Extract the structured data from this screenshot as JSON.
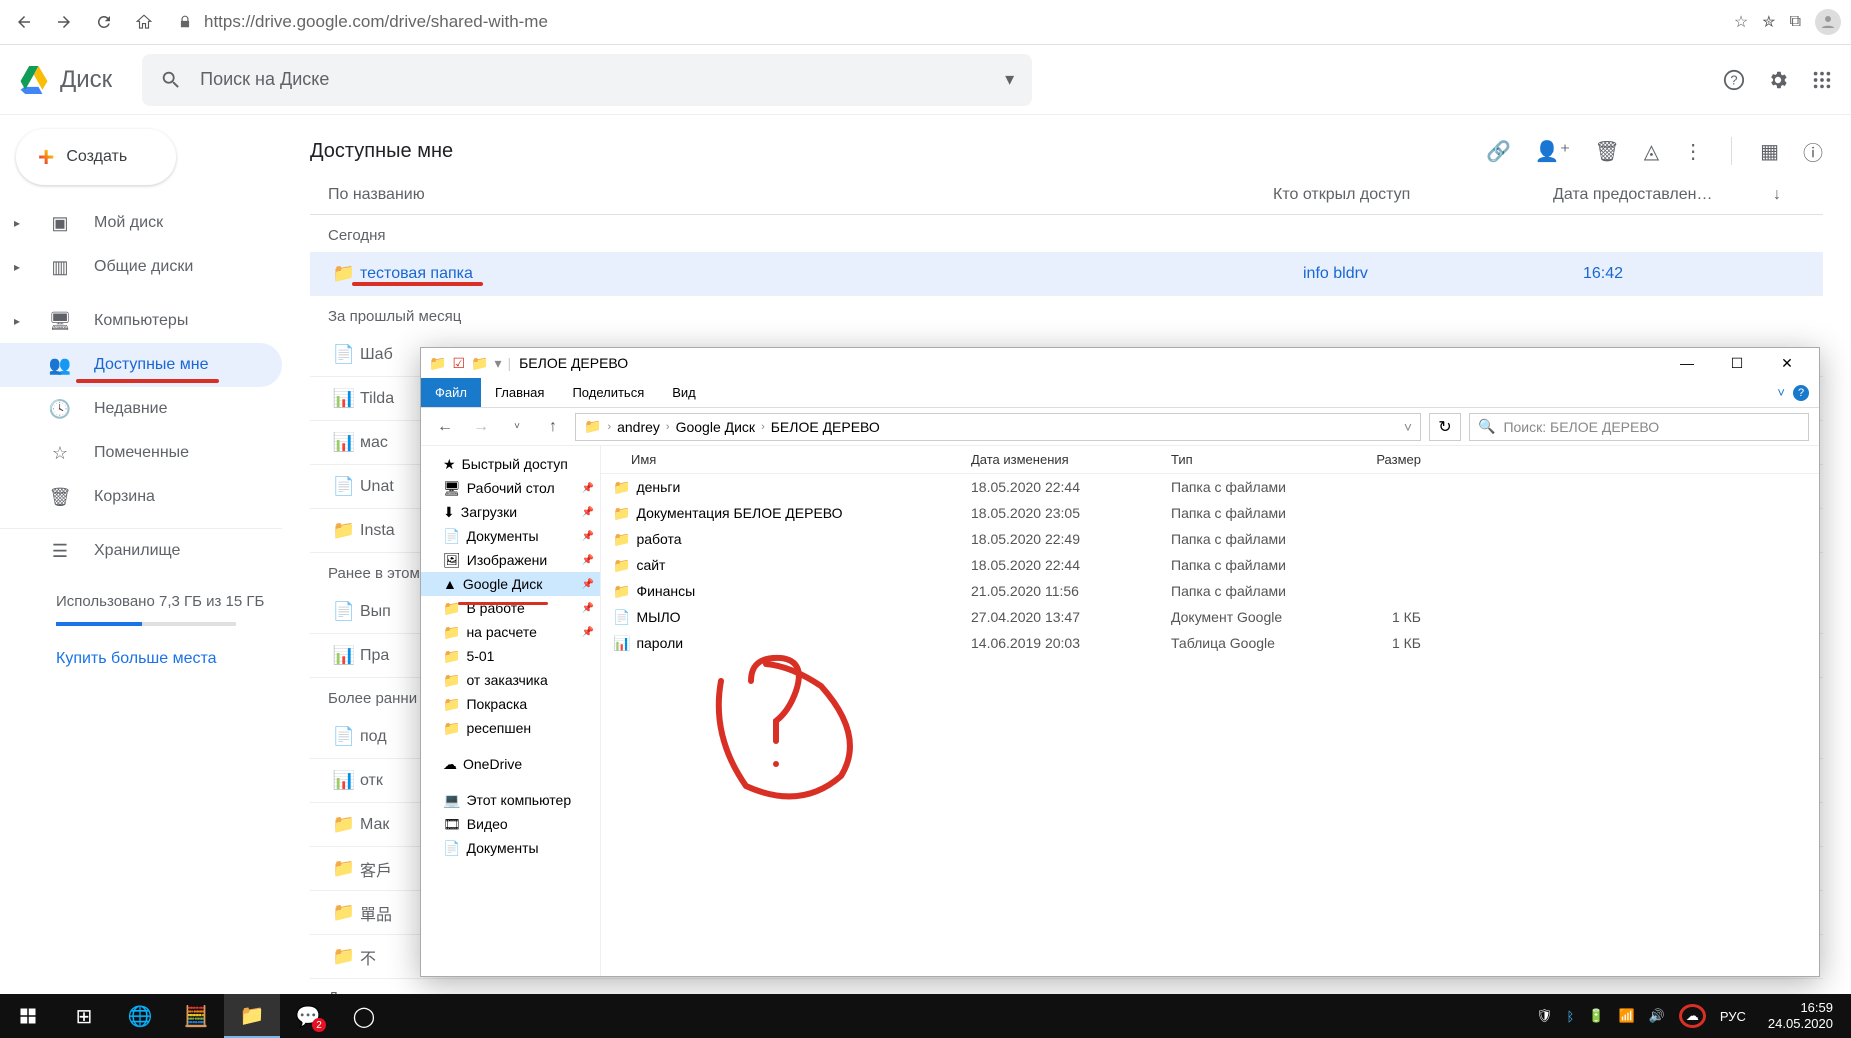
{
  "browser": {
    "url": "https://drive.google.com/drive/shared-with-me"
  },
  "drive": {
    "logo_text": "Диск",
    "search_placeholder": "Поиск на Диске",
    "create_label": "Создать",
    "sidebar": {
      "items": [
        {
          "label": "Мой диск",
          "icon": "drive"
        },
        {
          "label": "Общие диски",
          "icon": "shared-drives"
        },
        {
          "label": "Компьютеры",
          "icon": "computers"
        },
        {
          "label": "Доступные мне",
          "icon": "shared"
        },
        {
          "label": "Недавние",
          "icon": "recent"
        },
        {
          "label": "Помеченные",
          "icon": "starred"
        },
        {
          "label": "Корзина",
          "icon": "trash"
        }
      ],
      "storage_label": "Хранилище",
      "storage_text": "Использовано 7,3 ГБ из 15 ГБ",
      "buy_more": "Купить больше места"
    },
    "content": {
      "title": "Доступные мне",
      "col_name": "По названию",
      "col_shared": "Кто открыл доступ",
      "col_date": "Дата предоставлен…",
      "section_today": "Сегодня",
      "section_lastmonth": "За прошлый месяц",
      "section_earlier_month": "Ранее в этом",
      "section_earlier": "Более ранни",
      "available": "Доступные",
      "rows": {
        "test_folder": {
          "name": "тестовая папка",
          "shared": "info bldrv",
          "date": "16:42"
        },
        "shab": "Шаб",
        "tilda": "Tilda",
        "mas": "мас",
        "unat": "Unat",
        "insta": "Insta",
        "vyp": "Вып",
        "pra": "Пра",
        "pod": "под",
        "otk": "отк",
        "mak": "Мак",
        "cjk1": "客戶",
        "cjk2": "單品",
        "cjk3": "不"
      }
    }
  },
  "explorer": {
    "title": "БЕЛОЕ ДЕРЕВО",
    "ribbon": {
      "file": "Файл",
      "home": "Главная",
      "share": "Поделиться",
      "view": "Вид"
    },
    "breadcrumb": [
      "andrey",
      "Google Диск",
      "БЕЛОЕ ДЕРЕВО"
    ],
    "search_placeholder": "Поиск: БЕЛОЕ ДЕРЕВО",
    "tree": [
      {
        "label": "Быстрый доступ",
        "icon": "★"
      },
      {
        "label": "Рабочий стол",
        "icon": "🖥",
        "pin": true
      },
      {
        "label": "Загрузки",
        "icon": "⬇",
        "pin": true
      },
      {
        "label": "Документы",
        "icon": "📄",
        "pin": true
      },
      {
        "label": "Изображени",
        "icon": "🖼",
        "pin": true
      },
      {
        "label": "Google Диск",
        "icon": "▲",
        "pin": true,
        "selected": true,
        "redline": true
      },
      {
        "label": "В работе",
        "icon": "📁",
        "pin": true
      },
      {
        "label": "на расчете",
        "icon": "📁",
        "pin": true
      },
      {
        "label": "5-01",
        "icon": "📁"
      },
      {
        "label": "от заказчика",
        "icon": "📁"
      },
      {
        "label": "Покраска",
        "icon": "📁"
      },
      {
        "label": "ресепшен",
        "icon": "📁"
      },
      {
        "label": "OneDrive",
        "icon": "☁"
      },
      {
        "label": "Этот компьютер",
        "icon": "💻"
      },
      {
        "label": "Видео",
        "icon": "🎞"
      },
      {
        "label": "Документы",
        "icon": "📄"
      }
    ],
    "cols": {
      "name": "Имя",
      "date": "Дата изменения",
      "type": "Тип",
      "size": "Размер"
    },
    "rows": [
      {
        "name": "деньги",
        "date": "18.05.2020 22:44",
        "type": "Папка с файлами",
        "size": ""
      },
      {
        "name": "Документация БЕЛОЕ ДЕРЕВО",
        "date": "18.05.2020 23:05",
        "type": "Папка с файлами",
        "size": ""
      },
      {
        "name": "работа",
        "date": "18.05.2020 22:49",
        "type": "Папка с файлами",
        "size": ""
      },
      {
        "name": "сайт",
        "date": "18.05.2020 22:44",
        "type": "Папка с файлами",
        "size": ""
      },
      {
        "name": "Финансы",
        "date": "21.05.2020 11:56",
        "type": "Папка с файлами",
        "size": ""
      },
      {
        "name": "МЫЛО",
        "date": "27.04.2020 13:47",
        "type": "Документ Google",
        "size": "1 КБ"
      },
      {
        "name": "пароли",
        "date": "14.06.2019 20:03",
        "type": "Таблица Google",
        "size": "1 КБ"
      }
    ]
  },
  "taskbar": {
    "lang": "РУС",
    "time": "16:59",
    "date": "24.05.2020"
  }
}
